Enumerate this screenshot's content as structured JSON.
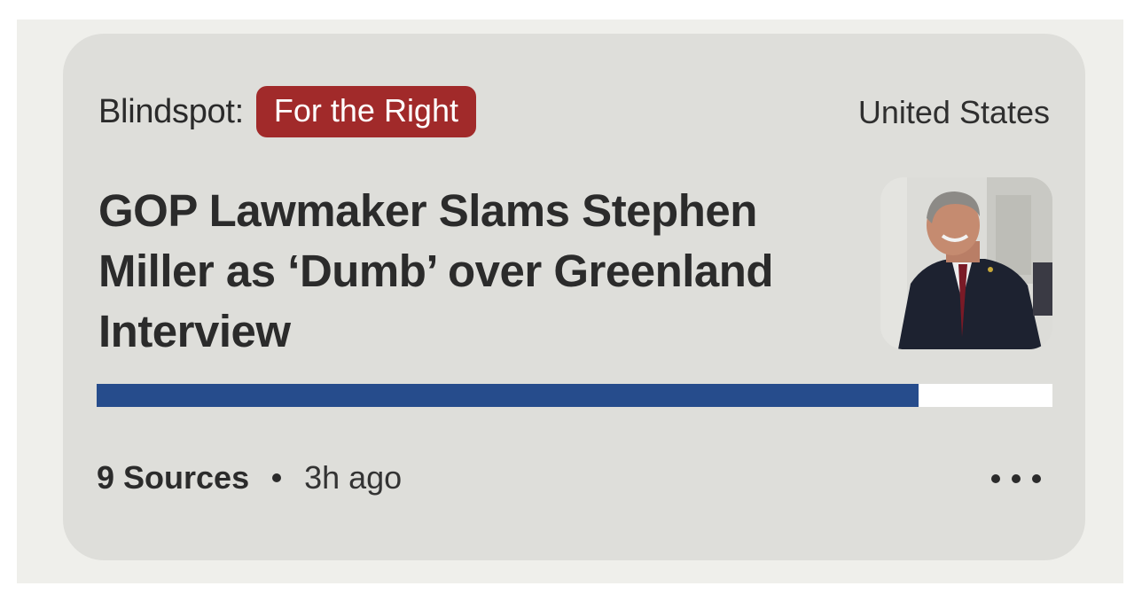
{
  "story": {
    "blindspot_label": "Blindspot:",
    "blindspot_side": "For the Right",
    "region": "United States",
    "headline": "GOP Lawmaker Slams Stephen Miller as ‘Dumb’ over Greenland Interview",
    "thumbnail_icon": "news-photo-politician",
    "bias_bar": {
      "left_fraction": 0.86,
      "left_color": "#264c8c",
      "right_color": "#ffffff"
    },
    "sources": "9 Sources",
    "time_ago": "3h ago",
    "more_icon": "ellipsis-icon"
  },
  "colors": {
    "badge": "#a12a2a",
    "card": "#dededa",
    "text": "#2b2b2b"
  }
}
